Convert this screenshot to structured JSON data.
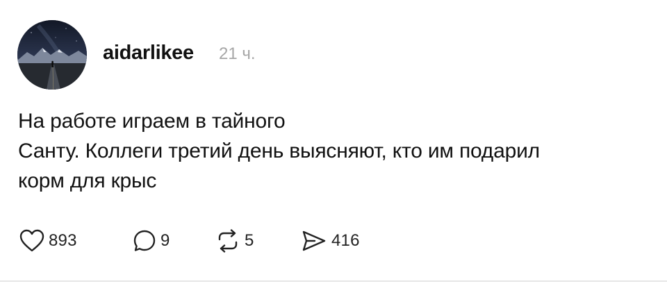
{
  "post": {
    "author": "aidarlikee",
    "time": "21 ч.",
    "text_lines": [
      "На работе играем в тайного",
      "Санту. Коллеги третий день выясняют, кто им подарил",
      "корм для крыс"
    ],
    "actions": {
      "likes": {
        "icon": "heart-icon",
        "count": "893"
      },
      "replies": {
        "icon": "comment-icon",
        "count": "9"
      },
      "reposts": {
        "icon": "repost-icon",
        "count": "5"
      },
      "shares": {
        "icon": "send-icon",
        "count": "416"
      }
    }
  }
}
